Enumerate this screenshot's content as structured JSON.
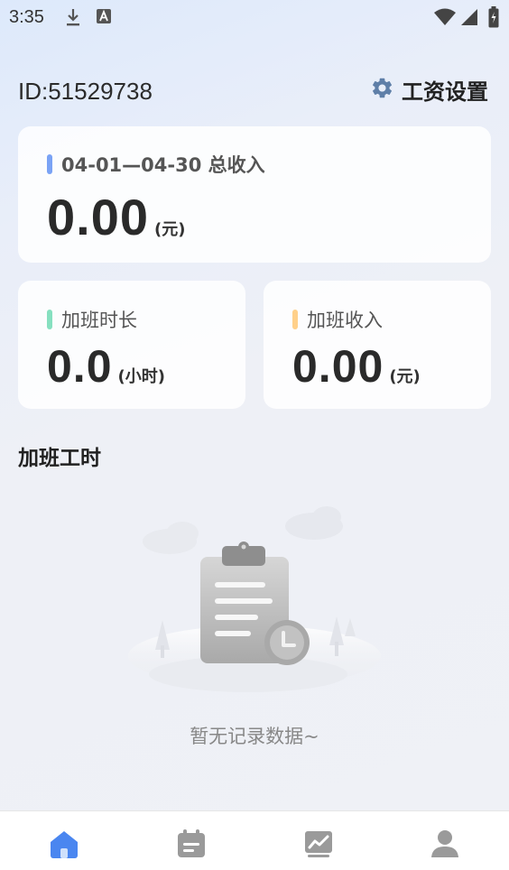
{
  "status_bar": {
    "time": "3:35",
    "icons": [
      "download-icon",
      "font-a-icon",
      "wifi-icon",
      "signal-icon",
      "battery-charging-icon"
    ]
  },
  "header": {
    "user_id": "ID:51529738",
    "settings_label": "工资设置",
    "settings_icon": "gear-icon"
  },
  "summary": {
    "total": {
      "title": "04-01—04-30 总收入",
      "value": "0.00",
      "unit": "(元)",
      "marker_color": "#7aa3f5"
    },
    "overtime_hours": {
      "title": "加班时长",
      "value": "0.0",
      "unit": "(小时)",
      "marker_color": "#86e0c0"
    },
    "overtime_income": {
      "title": "加班收入",
      "value": "0.00",
      "unit": "(元)",
      "marker_color": "#ffd089"
    }
  },
  "section": {
    "title": "加班工时"
  },
  "empty_state": {
    "illustration": "clipboard-clock-illustration",
    "text": "暂无记录数据~"
  },
  "bottom_nav": {
    "items": [
      {
        "icon": "home-icon",
        "active": true
      },
      {
        "icon": "calendar-icon",
        "active": false
      },
      {
        "icon": "chart-icon",
        "active": false
      },
      {
        "icon": "user-icon",
        "active": false
      }
    ],
    "active_color": "#4a86f0",
    "inactive_color": "#999999"
  }
}
